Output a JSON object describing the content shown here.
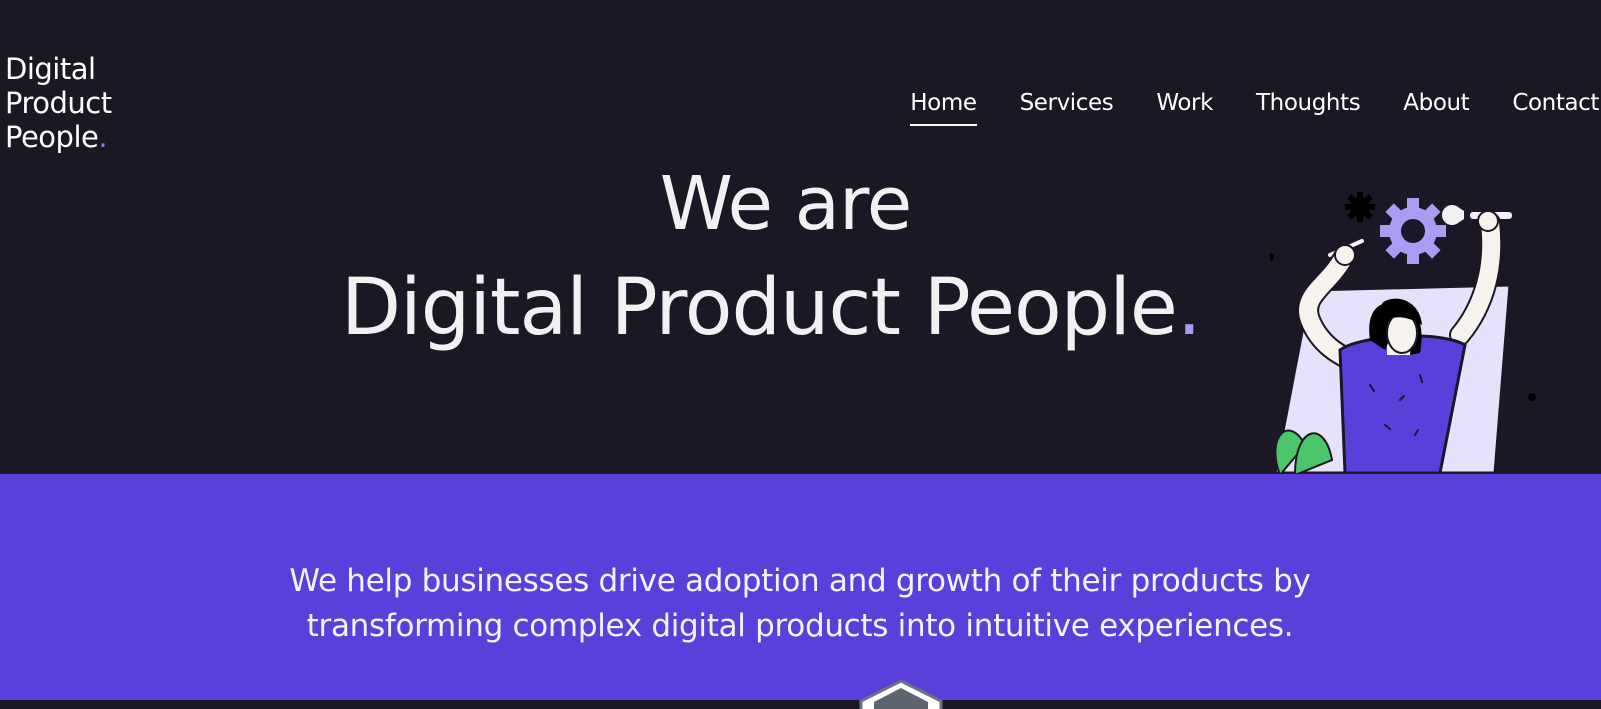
{
  "brand": {
    "logo_line1": "Digital",
    "logo_line2": "Product",
    "logo_line3": "People",
    "logo_dot": ".",
    "accent": "#8a7cf0"
  },
  "nav": {
    "items": [
      {
        "label": "Home",
        "active": true
      },
      {
        "label": "Services"
      },
      {
        "label": "Work"
      },
      {
        "label": "Thoughts"
      },
      {
        "label": "About"
      },
      {
        "label": "Contact"
      }
    ]
  },
  "hero": {
    "headline_line1": "We are",
    "headline_line2": "Digital Product People",
    "headline_dot": ".",
    "background": "#1c1724",
    "illustration": "person-fixing-gears-illustration"
  },
  "intro": {
    "tagline": "We help businesses drive adoption and growth of their products by transforming complex digital products into intuitive experiences.",
    "background": "#5a3fdb",
    "badge_icon": "hexagon-badge-icon"
  }
}
